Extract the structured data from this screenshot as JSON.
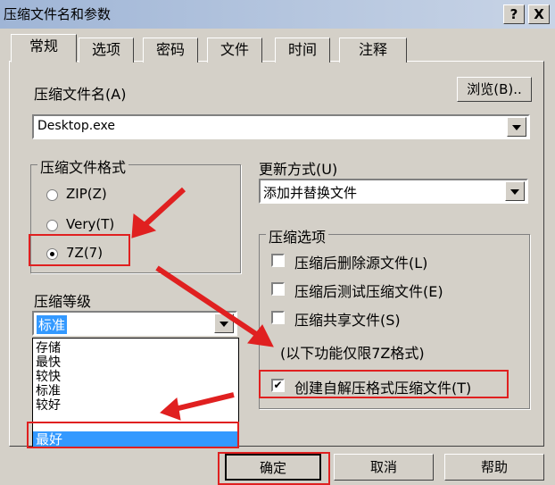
{
  "window": {
    "title": "压缩文件名和参数",
    "help_btn": "?",
    "close_btn": "X"
  },
  "tabs": [
    "常规",
    "选项",
    "密码",
    "文件",
    "时间",
    "注释"
  ],
  "archive_name": {
    "label": "压缩文件名(A)",
    "browse": "浏览(B)..",
    "value": "Desktop.exe"
  },
  "format": {
    "label": "压缩文件格式",
    "options": [
      "ZIP(Z)",
      "Very(T)",
      "7Z(7)"
    ],
    "selected": "7Z(7)"
  },
  "update": {
    "label": "更新方式(U)",
    "value": "添加并替换文件"
  },
  "compress_options": {
    "label": "压缩选项",
    "items": [
      "压缩后删除源文件(L)",
      "压缩后测试压缩文件(E)",
      "压缩共享文件(S)"
    ],
    "note": "(以下功能仅限7Z格式)",
    "sfx": "创建自解压格式压缩文件(T)",
    "sfx_checked": true
  },
  "level": {
    "label": "压缩等级",
    "value": "标准",
    "options": [
      "存储",
      "最快",
      "较快",
      "标准",
      "较好",
      "最好"
    ],
    "highlighted": "最好"
  },
  "buttons": {
    "ok": "确定",
    "cancel": "取消",
    "help": "帮助"
  },
  "colors": {
    "highlight": "#3399ff",
    "annotation": "#e02020"
  }
}
